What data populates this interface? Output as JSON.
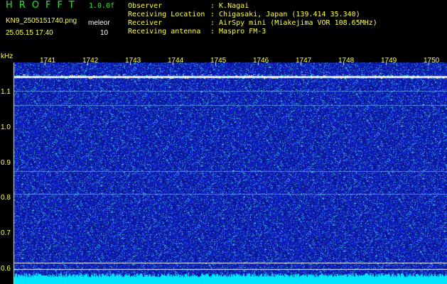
{
  "header": {
    "logo": "HROFFT",
    "version": "1.0.0f",
    "filename": "KN9_2505151740.png",
    "mode": "meleor",
    "datetime": "25.05.15 17:40",
    "count": "10",
    "observer_label": "Observer",
    "observer_value": ": K.Nagai",
    "location_label": "Receiving Location",
    "location_value": ": Chigasaki, Japan (139.414 35.340)",
    "receiver_label": "Receiver",
    "receiver_value": ": AirSpy mini (Miakejima VOR 108.65MHz)",
    "antenna_label": "Receiving antenna",
    "antenna_value": ": Maspro FM-3"
  },
  "axis": {
    "y_unit": "kHz",
    "y_ticks": [
      "1.1",
      "1.0",
      "0.9",
      "0.8",
      "0.7",
      "0.6"
    ],
    "x_ticks": [
      "1741",
      "1742",
      "1743",
      "1744",
      "1745",
      "1746",
      "1747",
      "1748",
      "1749",
      "1750"
    ]
  },
  "colors": {
    "background_noise": "#0a148c",
    "carrier": "#ffffff",
    "baseline": "#00e5ff",
    "label": "#ffff3c",
    "title": "#2fe02f"
  }
}
